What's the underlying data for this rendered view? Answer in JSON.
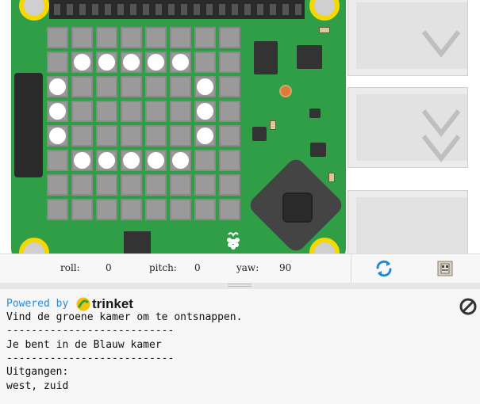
{
  "emulator": {
    "led_rows": [
      [
        0,
        0,
        0,
        0,
        0,
        0,
        0,
        0
      ],
      [
        0,
        1,
        1,
        1,
        1,
        1,
        0,
        0
      ],
      [
        1,
        0,
        0,
        0,
        0,
        0,
        1,
        0
      ],
      [
        1,
        0,
        0,
        0,
        0,
        0,
        1,
        0
      ],
      [
        1,
        0,
        0,
        0,
        0,
        0,
        1,
        0
      ],
      [
        0,
        1,
        1,
        1,
        1,
        1,
        0,
        0
      ],
      [
        0,
        0,
        0,
        0,
        0,
        0,
        0,
        0
      ],
      [
        0,
        0,
        0,
        0,
        0,
        0,
        0,
        0
      ]
    ],
    "led_on_color": "#ffffff",
    "led_off_color": "#9a9a9a",
    "board_color": "#2f9e46"
  },
  "sensors": {
    "roll_label": "roll:",
    "roll_value": "0",
    "pitch_label": "pitch:",
    "pitch_value": "0",
    "yaw_label": "yaw:",
    "yaw_value": "90",
    "refresh_icon": "refresh-icon",
    "chip_icon": "chip-icon",
    "accent_color": "#1f8ad6"
  },
  "console": {
    "powered_by": "Powered by",
    "brand": "trinket",
    "stop_icon": "stop-icon",
    "lines": [
      "Vind de groene kamer om te ontsnappen.",
      "---------------------------",
      "Je bent in de Blauw kamer",
      "---------------------------",
      "Uitgangen:",
      "west, zuid"
    ]
  }
}
